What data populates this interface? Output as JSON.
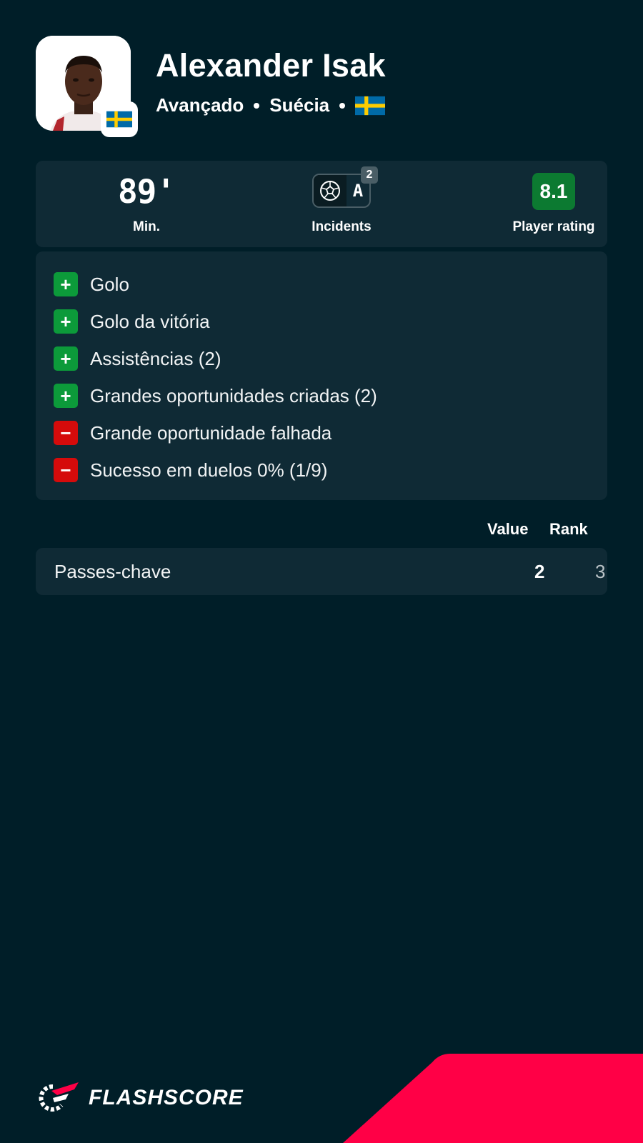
{
  "player": {
    "name": "Alexander Isak",
    "position": "Avançado",
    "country": "Suécia"
  },
  "summary": {
    "minutes": "89'",
    "minutes_label": "Min.",
    "incidents_label": "Incidents",
    "incident_letter": "A",
    "incident_count": "2",
    "rating": "8.1",
    "rating_label": "Player rating"
  },
  "features": [
    {
      "sign": "+",
      "type": "positive",
      "text": "Golo"
    },
    {
      "sign": "+",
      "type": "positive",
      "text": "Golo da vitória"
    },
    {
      "sign": "+",
      "type": "positive",
      "text": "Assistências (2)"
    },
    {
      "sign": "+",
      "type": "positive",
      "text": "Grandes oportunidades criadas (2)"
    },
    {
      "sign": "−",
      "type": "negative",
      "text": "Grande oportunidade falhada"
    },
    {
      "sign": "−",
      "type": "negative",
      "text": "Sucesso em duelos 0% (1/9)"
    }
  ],
  "table": {
    "headers": {
      "value": "Value",
      "rank": "Rank"
    },
    "rows": [
      {
        "label": "Passes-chave",
        "value": "2",
        "rank": "3"
      }
    ]
  },
  "brand": {
    "name": "FLASHSCORE"
  },
  "colors": {
    "background": "#001e28",
    "card": "#0f2a35",
    "positive": "#0c9a3a",
    "negative": "#d50b0b",
    "rating": "#0c7a31",
    "accent": "#ff0046"
  },
  "icons": [
    "player-photo",
    "sweden-flag-icon",
    "football-icon",
    "plus-icon",
    "minus-icon",
    "flashscore-logo-icon"
  ]
}
